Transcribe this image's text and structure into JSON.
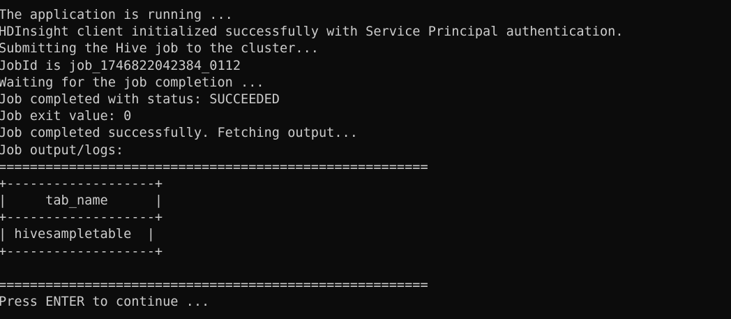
{
  "terminal": {
    "lines": [
      "The application is running ...",
      "HDInsight client initialized successfully with Service Principal authentication.",
      "Submitting the Hive job to the cluster...",
      "JobId is job_1746822042384_0112",
      "Waiting for the job completion ...",
      "Job completed with status: SUCCEEDED",
      "Job exit value: 0",
      "Job completed successfully. Fetching output...",
      "Job output/logs:",
      "=======================================================",
      "+-------------------+",
      "|     tab_name      |",
      "+-------------------+",
      "| hivesampletable  |",
      "+-------------------+",
      "",
      "=======================================================",
      "Press ENTER to continue ..."
    ]
  },
  "colors": {
    "background": "#0c0c0c",
    "foreground": "#cccccc"
  }
}
